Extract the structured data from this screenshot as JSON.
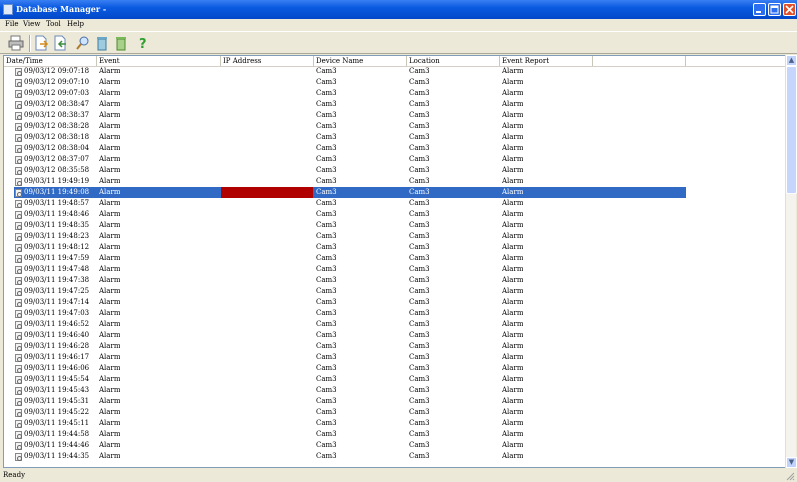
{
  "window": {
    "title": "Database Manager -"
  },
  "menu": [
    "File",
    "View",
    "Tool",
    "Help"
  ],
  "columns": [
    "Date/Time",
    "Event",
    "IP Address",
    "Device Name",
    "Location",
    "Event Report"
  ],
  "rows": [
    {
      "dt": "09/03/12 09:07:18",
      "event": "Alarm",
      "ip": "",
      "device": "Cam3",
      "location": "Cam3",
      "report": "Alarm"
    },
    {
      "dt": "09/03/12 09:07:10",
      "event": "Alarm",
      "ip": "",
      "device": "Cam3",
      "location": "Cam3",
      "report": "Alarm"
    },
    {
      "dt": "09/03/12 09:07:03",
      "event": "Alarm",
      "ip": "",
      "device": "Cam3",
      "location": "Cam3",
      "report": "Alarm"
    },
    {
      "dt": "09/03/12 08:38:47",
      "event": "Alarm",
      "ip": "",
      "device": "Cam3",
      "location": "Cam3",
      "report": "Alarm"
    },
    {
      "dt": "09/03/12 08:38:37",
      "event": "Alarm",
      "ip": "",
      "device": "Cam3",
      "location": "Cam3",
      "report": "Alarm"
    },
    {
      "dt": "09/03/12 08:38:28",
      "event": "Alarm",
      "ip": "",
      "device": "Cam3",
      "location": "Cam3",
      "report": "Alarm"
    },
    {
      "dt": "09/03/12 08:38:18",
      "event": "Alarm",
      "ip": "",
      "device": "Cam3",
      "location": "Cam3",
      "report": "Alarm"
    },
    {
      "dt": "09/03/12 08:38:04",
      "event": "Alarm",
      "ip": "",
      "device": "Cam3",
      "location": "Cam3",
      "report": "Alarm"
    },
    {
      "dt": "09/03/12 08:37:07",
      "event": "Alarm",
      "ip": "",
      "device": "Cam3",
      "location": "Cam3",
      "report": "Alarm"
    },
    {
      "dt": "09/03/12 08:35:58",
      "event": "Alarm",
      "ip": "",
      "device": "Cam3",
      "location": "Cam3",
      "report": "Alarm"
    },
    {
      "dt": "09/03/11 19:49:19",
      "event": "Alarm",
      "ip": "",
      "device": "Cam3",
      "location": "Cam3",
      "report": "Alarm"
    },
    {
      "dt": "09/03/11 19:49:08",
      "event": "Alarm",
      "ip": "",
      "device": "Cam3",
      "location": "Cam3",
      "report": "Alarm"
    },
    {
      "dt": "09/03/11 19:48:57",
      "event": "Alarm",
      "ip": "",
      "device": "Cam3",
      "location": "Cam3",
      "report": "Alarm"
    },
    {
      "dt": "09/03/11 19:48:46",
      "event": "Alarm",
      "ip": "",
      "device": "Cam3",
      "location": "Cam3",
      "report": "Alarm"
    },
    {
      "dt": "09/03/11 19:48:35",
      "event": "Alarm",
      "ip": "",
      "device": "Cam3",
      "location": "Cam3",
      "report": "Alarm"
    },
    {
      "dt": "09/03/11 19:48:23",
      "event": "Alarm",
      "ip": "",
      "device": "Cam3",
      "location": "Cam3",
      "report": "Alarm"
    },
    {
      "dt": "09/03/11 19:48:12",
      "event": "Alarm",
      "ip": "",
      "device": "Cam3",
      "location": "Cam3",
      "report": "Alarm"
    },
    {
      "dt": "09/03/11 19:47:59",
      "event": "Alarm",
      "ip": "",
      "device": "Cam3",
      "location": "Cam3",
      "report": "Alarm"
    },
    {
      "dt": "09/03/11 19:47:48",
      "event": "Alarm",
      "ip": "",
      "device": "Cam3",
      "location": "Cam3",
      "report": "Alarm"
    },
    {
      "dt": "09/03/11 19:47:38",
      "event": "Alarm",
      "ip": "",
      "device": "Cam3",
      "location": "Cam3",
      "report": "Alarm"
    },
    {
      "dt": "09/03/11 19:47:25",
      "event": "Alarm",
      "ip": "",
      "device": "Cam3",
      "location": "Cam3",
      "report": "Alarm"
    },
    {
      "dt": "09/03/11 19:47:14",
      "event": "Alarm",
      "ip": "",
      "device": "Cam3",
      "location": "Cam3",
      "report": "Alarm"
    },
    {
      "dt": "09/03/11 19:47:03",
      "event": "Alarm",
      "ip": "",
      "device": "Cam3",
      "location": "Cam3",
      "report": "Alarm"
    },
    {
      "dt": "09/03/11 19:46:52",
      "event": "Alarm",
      "ip": "",
      "device": "Cam3",
      "location": "Cam3",
      "report": "Alarm"
    },
    {
      "dt": "09/03/11 19:46:40",
      "event": "Alarm",
      "ip": "",
      "device": "Cam3",
      "location": "Cam3",
      "report": "Alarm"
    },
    {
      "dt": "09/03/11 19:46:28",
      "event": "Alarm",
      "ip": "",
      "device": "Cam3",
      "location": "Cam3",
      "report": "Alarm"
    },
    {
      "dt": "09/03/11 19:46:17",
      "event": "Alarm",
      "ip": "",
      "device": "Cam3",
      "location": "Cam3",
      "report": "Alarm"
    },
    {
      "dt": "09/03/11 19:46:06",
      "event": "Alarm",
      "ip": "",
      "device": "Cam3",
      "location": "Cam3",
      "report": "Alarm"
    },
    {
      "dt": "09/03/11 19:45:54",
      "event": "Alarm",
      "ip": "",
      "device": "Cam3",
      "location": "Cam3",
      "report": "Alarm"
    },
    {
      "dt": "09/03/11 19:45:43",
      "event": "Alarm",
      "ip": "",
      "device": "Cam3",
      "location": "Cam3",
      "report": "Alarm"
    },
    {
      "dt": "09/03/11 19:45:31",
      "event": "Alarm",
      "ip": "",
      "device": "Cam3",
      "location": "Cam3",
      "report": "Alarm"
    },
    {
      "dt": "09/03/11 19:45:22",
      "event": "Alarm",
      "ip": "",
      "device": "Cam3",
      "location": "Cam3",
      "report": "Alarm"
    },
    {
      "dt": "09/03/11 19:45:11",
      "event": "Alarm",
      "ip": "",
      "device": "Cam3",
      "location": "Cam3",
      "report": "Alarm"
    },
    {
      "dt": "09/03/11 19:44:58",
      "event": "Alarm",
      "ip": "",
      "device": "Cam3",
      "location": "Cam3",
      "report": "Alarm"
    },
    {
      "dt": "09/03/11 19:44:46",
      "event": "Alarm",
      "ip": "",
      "device": "Cam3",
      "location": "Cam3",
      "report": "Alarm"
    },
    {
      "dt": "09/03/11 19:44:35",
      "event": "Alarm",
      "ip": "",
      "device": "Cam3",
      "location": "Cam3",
      "report": "Alarm"
    }
  ],
  "selected_row": 11,
  "selection_color": "#316ac5",
  "ip_highlight_color": "#b00000",
  "status": "Ready"
}
